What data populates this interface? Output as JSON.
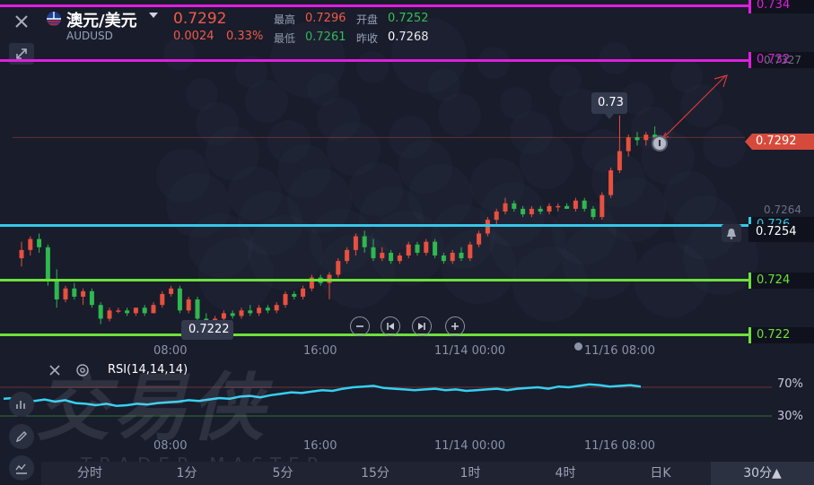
{
  "header": {
    "symbol_cn": "澳元/美元",
    "symbol_code": "AUDUSD",
    "price": "0.7292",
    "change": "0.0024",
    "change_pct": "0.33%",
    "high_label": "最高",
    "high_value": "0.7296",
    "low_label": "最低",
    "low_value": "0.7261",
    "open_label": "开盘",
    "open_value": "0.7252",
    "prev_close_label": "昨收",
    "prev_close_value": "0.7268"
  },
  "price_axis": {
    "top_tick": "0.7327",
    "mid_tick": "0.7264",
    "current_price_tag": "0.7292",
    "alert_price": "0.7254",
    "peak_label": "0.73",
    "low_label": "0.7222"
  },
  "level_lines": [
    {
      "value": "0.734",
      "color": "#e01ee0"
    },
    {
      "value": "0.732",
      "color": "#e01ee0"
    },
    {
      "value": "0.726",
      "color": "#35c8e8"
    },
    {
      "value": "0.724",
      "color": "#6fe03a"
    },
    {
      "value": "0.722",
      "color": "#6fe03a"
    }
  ],
  "time_axis": [
    "08:00",
    "16:00",
    "11/14 00:00",
    "11/16 08:00"
  ],
  "rsi": {
    "label": "RSI(14,14,14)",
    "upper": "70%",
    "lower": "30%",
    "values": [
      54,
      55,
      52,
      51,
      53,
      50,
      52,
      48,
      47,
      45,
      47,
      44,
      45,
      47,
      46,
      48,
      49,
      50,
      52,
      51,
      53,
      55,
      54,
      57,
      58,
      56,
      59,
      61,
      63,
      62,
      64,
      66,
      65,
      68,
      70,
      71,
      72,
      69,
      68,
      67,
      66,
      67,
      68,
      66,
      67,
      65,
      66,
      67,
      68,
      66,
      68,
      69,
      70,
      68,
      71,
      70,
      72,
      74,
      73,
      71,
      72,
      73,
      71
    ],
    "color": "#35d0f0"
  },
  "watermark": {
    "cn": "交易侠",
    "en": "TRADER MASTER"
  },
  "timeframes": [
    "分时",
    "1分",
    "5分",
    "15分",
    "1时",
    "4时",
    "日K",
    "30分▲"
  ],
  "chart_data": {
    "type": "candlestick",
    "series": [
      {
        "name": "AUDUSD",
        "values": [
          [
            0.7248,
            0.7254,
            0.7245,
            0.7251
          ],
          [
            0.7251,
            0.7256,
            0.7249,
            0.7255
          ],
          [
            0.7255,
            0.7257,
            0.725,
            0.7252
          ],
          [
            0.7252,
            0.7253,
            0.7238,
            0.724
          ],
          [
            0.724,
            0.7244,
            0.723,
            0.7233
          ],
          [
            0.7233,
            0.7238,
            0.7232,
            0.7237
          ],
          [
            0.7237,
            0.7239,
            0.7233,
            0.7234
          ],
          [
            0.7234,
            0.7237,
            0.7231,
            0.7236
          ],
          [
            0.7236,
            0.7237,
            0.723,
            0.7231
          ],
          [
            0.7231,
            0.7232,
            0.7224,
            0.7226
          ],
          [
            0.7226,
            0.723,
            0.7225,
            0.7229
          ],
          [
            0.7229,
            0.723,
            0.7228,
            0.7229
          ],
          [
            0.7229,
            0.723,
            0.7227,
            0.7228
          ],
          [
            0.7228,
            0.723,
            0.7227,
            0.723
          ],
          [
            0.723,
            0.7231,
            0.7227,
            0.7228
          ],
          [
            0.7228,
            0.7232,
            0.7228,
            0.7231
          ],
          [
            0.7231,
            0.7236,
            0.723,
            0.7235
          ],
          [
            0.7235,
            0.7238,
            0.7234,
            0.7237
          ],
          [
            0.7237,
            0.7238,
            0.7228,
            0.7229
          ],
          [
            0.7229,
            0.7234,
            0.7228,
            0.7233
          ],
          [
            0.7233,
            0.7234,
            0.7224,
            0.7226
          ],
          [
            0.7226,
            0.7228,
            0.7223,
            0.7225
          ],
          [
            0.7225,
            0.7227,
            0.7224,
            0.7226
          ],
          [
            0.7226,
            0.7229,
            0.7224,
            0.7228
          ],
          [
            0.7228,
            0.7229,
            0.7226,
            0.7227
          ],
          [
            0.7227,
            0.723,
            0.7226,
            0.7229
          ],
          [
            0.7229,
            0.7231,
            0.7227,
            0.7228
          ],
          [
            0.7228,
            0.7231,
            0.7227,
            0.723
          ],
          [
            0.723,
            0.7231,
            0.7228,
            0.7229
          ],
          [
            0.7229,
            0.7232,
            0.7228,
            0.7231
          ],
          [
            0.7231,
            0.7236,
            0.723,
            0.7235
          ],
          [
            0.7235,
            0.7236,
            0.7233,
            0.7234
          ],
          [
            0.7234,
            0.7238,
            0.7233,
            0.7237
          ],
          [
            0.7237,
            0.7242,
            0.7236,
            0.7241
          ],
          [
            0.7241,
            0.7242,
            0.7238,
            0.7239
          ],
          [
            0.7239,
            0.7243,
            0.7233,
            0.7242
          ],
          [
            0.7242,
            0.7248,
            0.7241,
            0.7247
          ],
          [
            0.7247,
            0.7252,
            0.7246,
            0.7251
          ],
          [
            0.7251,
            0.7257,
            0.7249,
            0.7256
          ],
          [
            0.7256,
            0.7258,
            0.725,
            0.7252
          ],
          [
            0.7252,
            0.7255,
            0.7247,
            0.7248
          ],
          [
            0.7248,
            0.7252,
            0.7247,
            0.725
          ],
          [
            0.725,
            0.7251,
            0.7246,
            0.7247
          ],
          [
            0.7247,
            0.725,
            0.7246,
            0.7249
          ],
          [
            0.7249,
            0.7254,
            0.7248,
            0.7253
          ],
          [
            0.7253,
            0.7254,
            0.7249,
            0.725
          ],
          [
            0.725,
            0.7255,
            0.7249,
            0.7254
          ],
          [
            0.7254,
            0.7255,
            0.7248,
            0.7249
          ],
          [
            0.7249,
            0.725,
            0.7246,
            0.7247
          ],
          [
            0.7247,
            0.7251,
            0.7246,
            0.725
          ],
          [
            0.725,
            0.7252,
            0.7247,
            0.7248
          ],
          [
            0.7248,
            0.7254,
            0.7247,
            0.7253
          ],
          [
            0.7253,
            0.7258,
            0.7252,
            0.7257
          ],
          [
            0.7257,
            0.7263,
            0.7256,
            0.7262
          ],
          [
            0.7262,
            0.7266,
            0.726,
            0.7265
          ],
          [
            0.7265,
            0.727,
            0.7264,
            0.7268
          ],
          [
            0.7268,
            0.7269,
            0.7265,
            0.7266
          ],
          [
            0.7266,
            0.7267,
            0.7263,
            0.7264
          ],
          [
            0.7264,
            0.7267,
            0.7263,
            0.7266
          ],
          [
            0.7266,
            0.7267,
            0.7264,
            0.7265
          ],
          [
            0.7265,
            0.7268,
            0.7264,
            0.7267
          ],
          [
            0.7267,
            0.7268,
            0.7265,
            0.7267
          ],
          [
            0.7267,
            0.7268,
            0.7266,
            0.7266
          ],
          [
            0.7266,
            0.727,
            0.7265,
            0.7269
          ],
          [
            0.7269,
            0.727,
            0.7265,
            0.7266
          ],
          [
            0.7266,
            0.7267,
            0.7262,
            0.7263
          ],
          [
            0.7263,
            0.7272,
            0.7262,
            0.7271
          ],
          [
            0.7271,
            0.7281,
            0.727,
            0.728
          ],
          [
            0.728,
            0.73,
            0.7279,
            0.7287
          ],
          [
            0.7287,
            0.7293,
            0.7285,
            0.7292
          ],
          [
            0.7292,
            0.7294,
            0.7289,
            0.7291
          ],
          [
            0.7291,
            0.7294,
            0.7289,
            0.7293
          ],
          [
            0.7293,
            0.7296,
            0.729,
            0.7292
          ]
        ]
      }
    ],
    "ylim": [
      0.7218,
      0.7342
    ]
  }
}
